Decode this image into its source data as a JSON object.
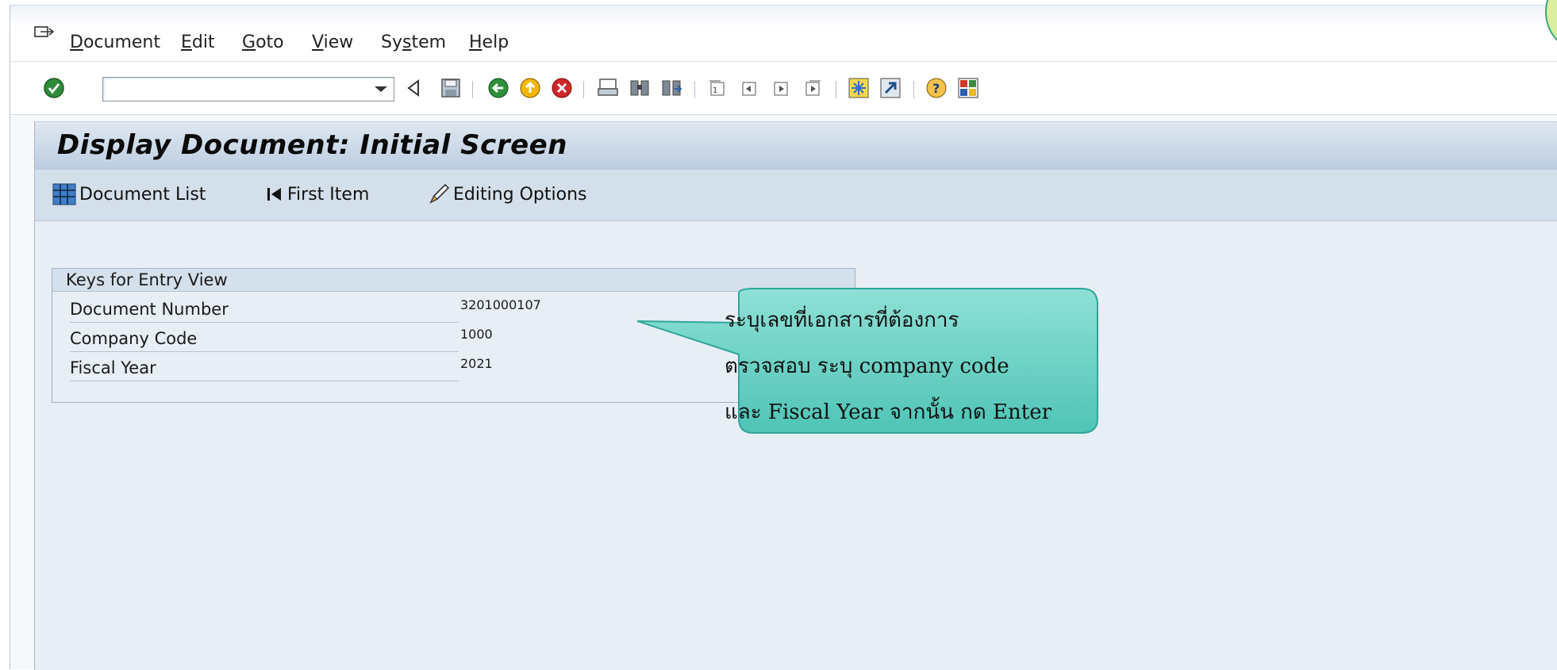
{
  "menu": {
    "items": [
      {
        "label_u": "D",
        "label_rest": "ocument"
      },
      {
        "label_u": "E",
        "label_rest": "dit"
      },
      {
        "label_u": "G",
        "label_rest": "oto"
      },
      {
        "label_u": "V",
        "label_rest": "iew"
      },
      {
        "label_u": "",
        "label_pre": "Sy",
        "label_u2": "s",
        "label_rest": "tem"
      },
      {
        "label_u": "H",
        "label_rest": "elp"
      }
    ]
  },
  "toolbar": {
    "command_value": "",
    "icons": [
      "enter-icon",
      "back-triangle-icon",
      "save-icon",
      "back-icon",
      "exit-icon",
      "cancel-icon",
      "print-icon",
      "find-icon",
      "find-next-icon",
      "first-page-icon",
      "previous-page-icon",
      "next-page-icon",
      "last-page-icon",
      "create-session-icon",
      "shortcut-icon",
      "help-icon",
      "layout-icon"
    ]
  },
  "screen": {
    "title": "Display Document: Initial Screen",
    "app_buttons": {
      "document_list": "Document List",
      "first_item": "First Item",
      "editing_options": "Editing Options"
    }
  },
  "groupbox": {
    "title": "Keys for Entry View",
    "fields": {
      "doc_number_label": "Document Number",
      "doc_number_value": "3201000107",
      "company_code_label": "Company Code",
      "company_code_value": "1000",
      "fiscal_year_label": "Fiscal Year",
      "fiscal_year_value": "2021"
    }
  },
  "callout": {
    "line1": "ระบุเลขที่เอกสารที่ต้องการ",
    "line2": "ตรวจสอบ  ระบุ company code",
    "line3": "และ Fiscal Year  จากนั้น กด Enter"
  },
  "colors": {
    "callout_fill": "#4fc4b6",
    "callout_border": "#2fa79a",
    "title_bar": "#c8d7e7"
  }
}
